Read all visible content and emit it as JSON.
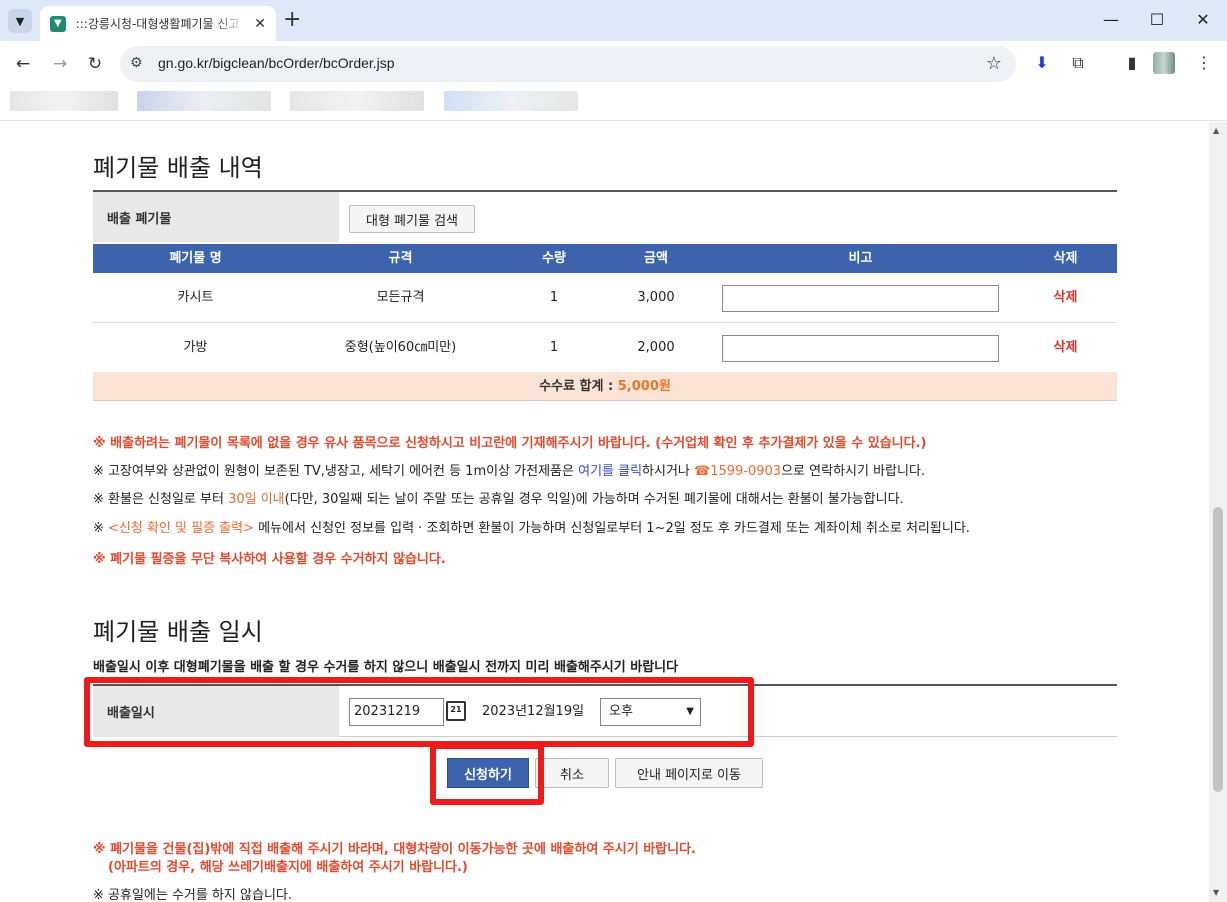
{
  "browser": {
    "tab_title": ":::강릉시청-대형생활폐기물 신고",
    "url": "gn.go.kr/bigclean/bcOrder/bcOrder.jsp"
  },
  "disposal_list": {
    "section_title": "폐기물 배출 내역",
    "label": "배출 폐기물",
    "search_button": "대형 폐기물 검색",
    "columns": [
      "폐기물 명",
      "규격",
      "수량",
      "금액",
      "비고",
      "삭제"
    ],
    "rows": [
      {
        "name": "카시트",
        "spec": "모든규격",
        "qty": "1",
        "amount": "3,000",
        "note": "",
        "delete": "삭제"
      },
      {
        "name": "가방",
        "spec": "중형(높이60㎝미만)",
        "qty": "1",
        "amount": "2,000",
        "note": "",
        "delete": "삭제"
      }
    ],
    "fee_label": "수수료 합계 :",
    "fee_value": "5,000원"
  },
  "notes": {
    "n1": "※ 배출하려는 폐기물이 목록에 없을 경우 유사 품목으로 신청하시고 비고란에 기재해주시기 바랍니다. (수거업체 확인 후 추가결제가 있을 수 있습니다.)",
    "n2_a": "※ 고장여부와 상관없이 원형이 보존된 TV,냉장고, 세탁기 에어컨 등 1m이상 가전제품은 ",
    "n2_link": "여기를 클릭",
    "n2_b": "하시거나 ",
    "n2_phone": "☎1599-0903",
    "n2_c": "으로 연락하시기 바랍니다.",
    "n3_a": "※ 환불은 신청일로 부터 ",
    "n3_hl": "30일 이내",
    "n3_b": "(다만, 30일째 되는 날이 주말 또는 공휴일 경우 익일)에 가능하며 수거된 폐기물에 대해서는 환불이 불가능합니다.",
    "n4_a": "※ ",
    "n4_hl": "<신청 확인 및 필증 출력>",
    "n4_b": " 메뉴에서 신청인 정보를 입력 · 조회하면 환불이 가능하며 신청일로부터 1~2일 정도 후 카드결제 또는 계좌이체 취소로 처리됩니다.",
    "n5": "※ 폐기물 필증을 무단 복사하여 사용할 경우 수거하지 않습니다."
  },
  "disposal_date": {
    "section_title": "폐기물 배출 일시",
    "subtitle": "배출일시 이후 대형폐기물을 배출 할 경우 수거를 하지 않으니 배출일시 전까지 미리 배출해주시기 바랍니다",
    "label": "배출일시",
    "date_value": "20231219",
    "date_text": "2023년12월19일",
    "ampm_selected": "오후"
  },
  "actions": {
    "submit": "신청하기",
    "cancel": "취소",
    "guide": "안내 페이지로 이동"
  },
  "bottom_notes": {
    "b1": "※ 폐기물을 건물(집)밖에 직접 배출해 주시기 바라며, 대형차량이 이동가능한 곳에 배출하여 주시기 바랍니다.",
    "b2": "(아파트의 경우, 해당 쓰레기배출지에 배출하여 주시기 바랍니다.)",
    "b3": "※ 공휴일에는 수거를 하지 않습니다."
  }
}
